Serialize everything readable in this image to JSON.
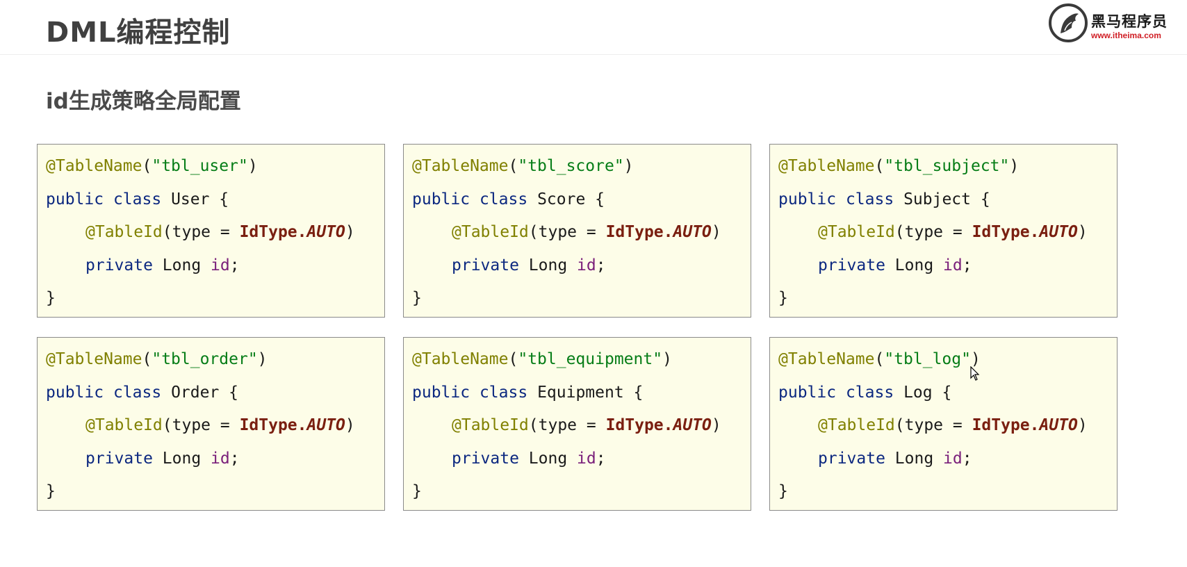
{
  "header": {
    "title": "DML编程控制",
    "logo": {
      "name_cn": "黑马程序员",
      "url": "www.itheima.com"
    }
  },
  "section": {
    "title": "id生成策略全局配置"
  },
  "code": {
    "annotation_table": "@TableName",
    "public_kw": "public",
    "class_kw": "class",
    "annotation_id": "@TableId",
    "type_text": "(type = ",
    "idtype": "IdType.",
    "auto": "AUTO",
    "close_paren": ")",
    "private_kw": "private",
    "long_type": "Long",
    "field": "id",
    "semicolon": ";",
    "brace_close": "}"
  },
  "cards": [
    {
      "table": "\"tbl_user\"",
      "class_name": "User"
    },
    {
      "table": "\"tbl_score\"",
      "class_name": "Score"
    },
    {
      "table": "\"tbl_subject\"",
      "class_name": "Subject"
    },
    {
      "table": "\"tbl_order\"",
      "class_name": "Order"
    },
    {
      "table": "\"tbl_equipment\"",
      "class_name": "Equipment"
    },
    {
      "table": "\"tbl_log\"",
      "class_name": "Log"
    }
  ],
  "colors": {
    "annotation": "#808000",
    "string": "#067d17",
    "keyword": "#0c2880",
    "field": "#7a1f7a",
    "enum": "#7a1f10",
    "card_bg": "#fdfde8"
  }
}
